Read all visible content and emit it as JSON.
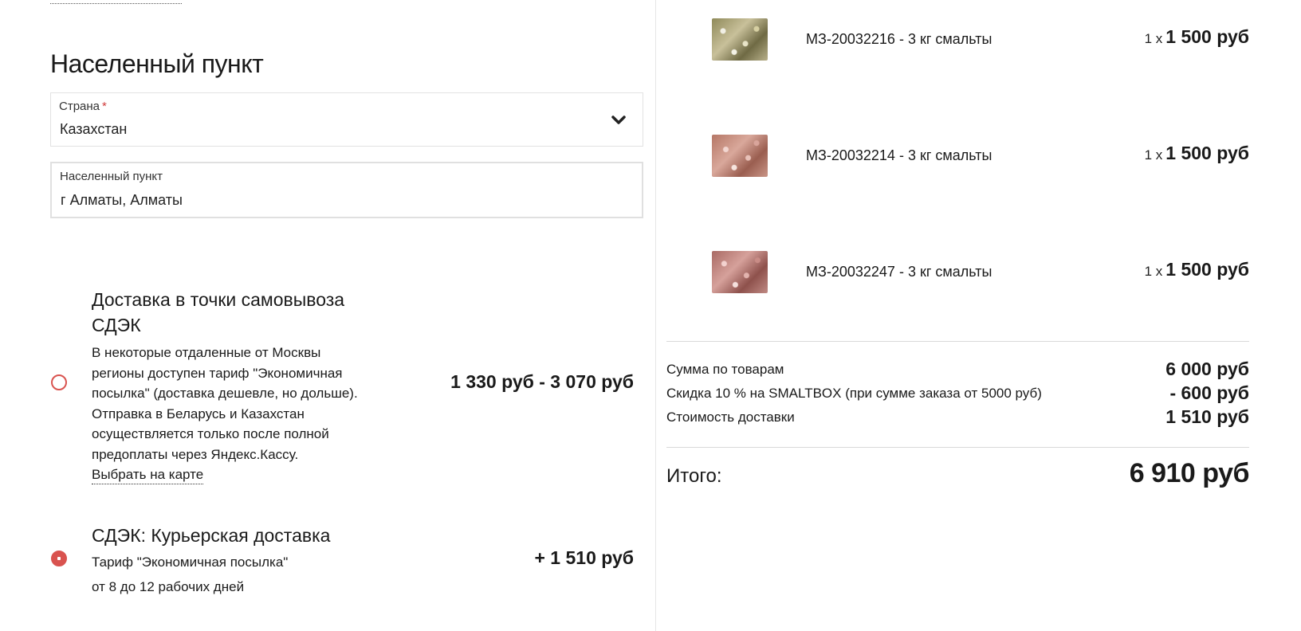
{
  "locality": {
    "section_title": "Населенный пункт",
    "country": {
      "label": "Страна",
      "required_mark": "*",
      "value": "Казахстан",
      "icon": "chevron-down-icon"
    },
    "city": {
      "label": "Населенный пункт",
      "value": "г Алматы, Алматы"
    }
  },
  "delivery_options": [
    {
      "title": "Доставка в точки самовывоза СДЭК",
      "description": "В некоторые отдаленные от Москвы регионы доступен тариф \"Экономичная посылка\" (доставка дешевле, но дольше). Отправка в Беларусь и Казахстан осуществляется только после полной предоплаты через Яндекс.Кассу.",
      "map_link": "Выбрать на карте",
      "price": "1 330 руб - 3 070 руб",
      "selected": false
    },
    {
      "title": "СДЭК: Курьерская доставка",
      "tariff": "Тариф \"Экономичная посылка\"",
      "term": "от 8 до 12 рабочих дней",
      "price": "+ 1 510 руб",
      "selected": true
    }
  ],
  "cart": {
    "items": [
      {
        "name": "МЗ-20032216 - 3 кг смальты",
        "qty": "1 x",
        "price": "1 500 руб"
      },
      {
        "name": "МЗ-20032214 - 3 кг смальты",
        "qty": "1 x",
        "price": "1 500 руб"
      },
      {
        "name": "МЗ-20032247 - 3 кг смальты",
        "qty": "1 x",
        "price": "1 500 руб"
      }
    ],
    "summary": {
      "goods_label": "Сумма по товарам",
      "goods_value": "6 000 руб",
      "discount_label": "Скидка 10 % на SMALTBOX (при сумме заказа от 5000 руб)",
      "discount_value": "- 600 руб",
      "delivery_label": "Стоимость доставки",
      "delivery_value": "1 510 руб"
    },
    "total_label": "Итого:",
    "total_value": "6 910 руб"
  },
  "colors": {
    "accent": "#d9534f",
    "text": "#1a1a1a",
    "border": "#e2e2e2"
  }
}
